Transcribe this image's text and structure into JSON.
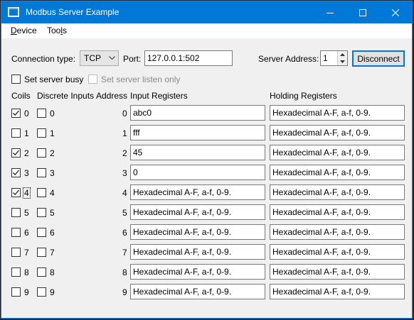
{
  "window": {
    "title": "Modbus Server Example",
    "accent": "#0078d7",
    "controls": [
      "minimize-icon",
      "maximize-icon",
      "close-icon"
    ]
  },
  "menu": {
    "device_label": "Device",
    "device_mnemonic": "D",
    "device_rest": "evice",
    "tools_label": "Tools",
    "tools_prefix": "Too",
    "tools_mnemonic": "l",
    "tools_rest": "s"
  },
  "connection": {
    "type_label": "Connection type:",
    "type_value": "TCP",
    "port_label": "Port:",
    "port_value": "127.0.0.1:502",
    "server_address_label": "Server Address:",
    "server_address_value": "1",
    "disconnect_label": "Disconnect"
  },
  "options": {
    "busy_label": "Set server busy",
    "busy_checked": false,
    "listen_only_label": "Set server listen only",
    "listen_only_checked": false,
    "listen_only_enabled": false
  },
  "headers": {
    "coils": "Coils",
    "discrete_inputs": "Discrete Inputs",
    "address": "Address",
    "input_registers": "Input Registers",
    "holding_registers": "Holding Registers"
  },
  "rows": [
    {
      "coil_label": "0",
      "coil_checked": true,
      "di_label": "0",
      "di_checked": false,
      "address": "0",
      "input_register": "abc0",
      "holding_register": "Hexadecimal A-F, a-f, 0-9."
    },
    {
      "coil_label": "1",
      "coil_checked": false,
      "di_label": "1",
      "di_checked": false,
      "address": "1",
      "input_register": "fff",
      "holding_register": "Hexadecimal A-F, a-f, 0-9."
    },
    {
      "coil_label": "2",
      "coil_checked": true,
      "di_label": "2",
      "di_checked": false,
      "address": "2",
      "input_register": "45",
      "holding_register": "Hexadecimal A-F, a-f, 0-9."
    },
    {
      "coil_label": "3",
      "coil_checked": true,
      "di_label": "3",
      "di_checked": false,
      "address": "3",
      "input_register": "0",
      "holding_register": "Hexadecimal A-F, a-f, 0-9."
    },
    {
      "coil_label": "4",
      "coil_checked": true,
      "di_label": "4",
      "di_checked": false,
      "address": "4",
      "input_register": "Hexadecimal A-F, a-f, 0-9.",
      "holding_register": "Hexadecimal A-F, a-f, 0-9.",
      "coil_focused": true
    },
    {
      "coil_label": "5",
      "coil_checked": false,
      "di_label": "5",
      "di_checked": false,
      "address": "5",
      "input_register": "Hexadecimal A-F, a-f, 0-9.",
      "holding_register": "Hexadecimal A-F, a-f, 0-9."
    },
    {
      "coil_label": "6",
      "coil_checked": false,
      "di_label": "6",
      "di_checked": false,
      "address": "6",
      "input_register": "Hexadecimal A-F, a-f, 0-9.",
      "holding_register": "Hexadecimal A-F, a-f, 0-9."
    },
    {
      "coil_label": "7",
      "coil_checked": false,
      "di_label": "7",
      "di_checked": false,
      "address": "7",
      "input_register": "Hexadecimal A-F, a-f, 0-9.",
      "holding_register": "Hexadecimal A-F, a-f, 0-9."
    },
    {
      "coil_label": "8",
      "coil_checked": false,
      "di_label": "8",
      "di_checked": false,
      "address": "8",
      "input_register": "Hexadecimal A-F, a-f, 0-9.",
      "holding_register": "Hexadecimal A-F, a-f, 0-9."
    },
    {
      "coil_label": "9",
      "coil_checked": false,
      "di_label": "9",
      "di_checked": false,
      "address": "9",
      "input_register": "Hexadecimal A-F, a-f, 0-9.",
      "holding_register": "Hexadecimal A-F, a-f, 0-9."
    }
  ]
}
